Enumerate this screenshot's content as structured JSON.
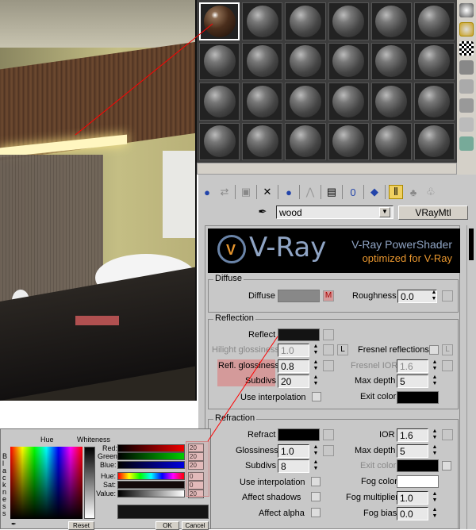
{
  "material_name": "wood",
  "material_type": "VRayMtl",
  "banner": {
    "logo": "V-Ray",
    "title": "V-Ray PowerShader",
    "subtitle": "optimized for V-Ray"
  },
  "diffuse": {
    "title": "Diffuse",
    "diffuse_label": "Diffuse",
    "map_button": "M",
    "roughness_label": "Roughness",
    "roughness": "0.0",
    "color": "#888888"
  },
  "reflection": {
    "title": "Reflection",
    "reflect_label": "Reflect",
    "reflect_color": "#141414",
    "hilight_label": "Hilight glossiness",
    "hilight": "1.0",
    "lock": "L",
    "fresnel_label": "Fresnel reflections",
    "fresnel_lock": "L",
    "refl_gloss_label": "Refl. glossiness",
    "refl_gloss": "0.8",
    "fresnel_ior_label": "Fresnel IOR",
    "fresnel_ior": "1.6",
    "subdivs_label": "Subdivs",
    "subdivs": "20",
    "max_depth_label": "Max depth",
    "max_depth": "5",
    "use_interp_label": "Use interpolation",
    "exit_color_label": "Exit color"
  },
  "refraction": {
    "title": "Refraction",
    "refract_label": "Refract",
    "ior_label": "IOR",
    "ior": "1.6",
    "gloss_label": "Glossiness",
    "gloss": "1.0",
    "max_depth_label": "Max depth",
    "max_depth": "5",
    "subdivs_label": "Subdivs",
    "subdivs": "8",
    "exit_color_label": "Exit color",
    "use_interp_label": "Use interpolation",
    "fog_color_label": "Fog color",
    "affect_shadows_label": "Affect shadows",
    "fog_mult_label": "Fog multiplier",
    "fog_mult": "1.0",
    "affect_alpha_label": "Affect alpha",
    "fog_bias_label": "Fog bias",
    "fog_bias": "0.0"
  },
  "picker": {
    "hue_label": "Hue",
    "whiteness_label": "Whiteness",
    "blackness_label": "Blackness",
    "red_label": "Red:",
    "green_label": "Green:",
    "blue_label": "Blue:",
    "hue2_label": "Hue:",
    "sat_label": "Sat:",
    "value_label": "Value:",
    "red": "20",
    "green": "20",
    "blue": "20",
    "hue": "0",
    "sat": "0",
    "value": "20",
    "reset": "Reset",
    "ok": "OK",
    "cancel": "Cancel"
  },
  "colors": {
    "highlight": "#d49a9a",
    "annotation_line": "#ff0000"
  }
}
